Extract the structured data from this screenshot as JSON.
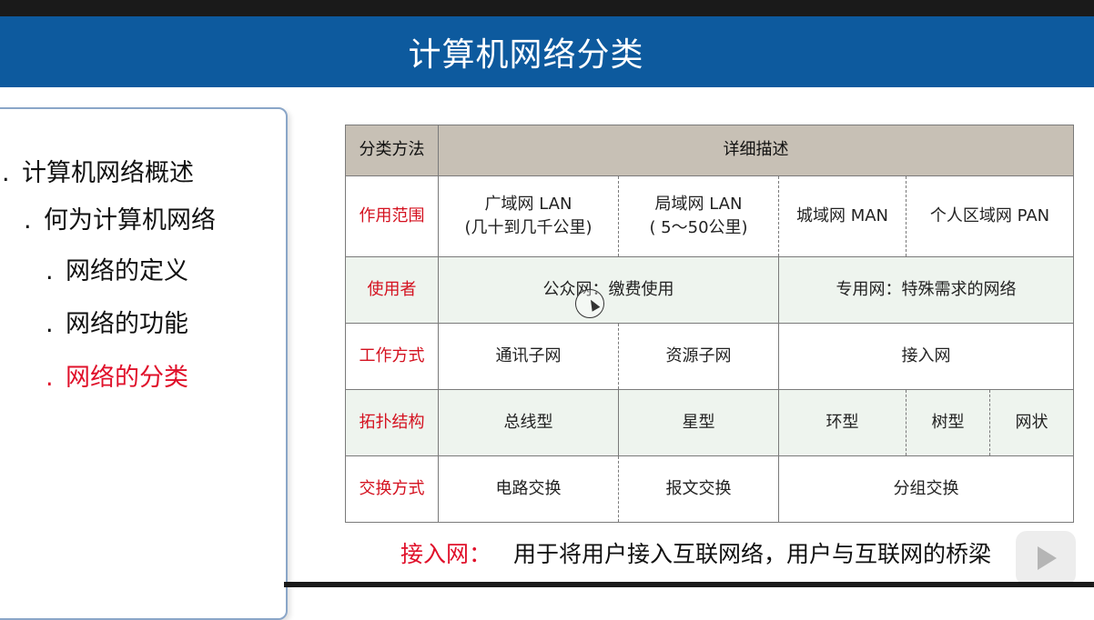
{
  "slide": {
    "title": "计算机网络分类"
  },
  "outline": {
    "items": [
      {
        "bullet": ".",
        "label": "计算机网络概述"
      },
      {
        "bullet": ".",
        "label": "何为计算机网络"
      },
      {
        "bullet": ".",
        "label": "网络的定义"
      },
      {
        "bullet": ".",
        "label": "网络的功能"
      },
      {
        "bullet": ".",
        "label": "网络的分类"
      }
    ],
    "active_index": 4
  },
  "table": {
    "headers": [
      "分类方法",
      "详细描述"
    ],
    "rows": {
      "scope": {
        "label": "作用范围",
        "cells": [
          "广域网 LAN\n(几十到几千公里)",
          "局域网 LAN\n( 5～50公里)",
          "城域网 MAN",
          "个人区域网 PAN"
        ]
      },
      "user": {
        "label": "使用者",
        "cells": [
          "公众网：缴费使用",
          "专用网：特殊需求的网络"
        ]
      },
      "mode": {
        "label": "工作方式",
        "cells": [
          "通讯子网",
          "资源子网",
          "接入网"
        ]
      },
      "topology": {
        "label": "拓扑结构",
        "cells": [
          "总线型",
          "星型",
          "环型",
          "树型",
          "网状"
        ]
      },
      "switching": {
        "label": "交换方式",
        "cells": [
          "电路交换",
          "报文交换",
          "分组交换"
        ]
      }
    }
  },
  "note": {
    "label": "接入网：",
    "text": "用于将用户接入互联网络，用户与互联网的桥梁"
  },
  "icons": {
    "cursor": "cursor-icon",
    "logo": "video-play-logo"
  },
  "colors": {
    "banner": "#0d5a9e",
    "accent_red": "#e0102a",
    "header_fill": "#c7c0b5",
    "row_shade": "#eef4ee"
  }
}
